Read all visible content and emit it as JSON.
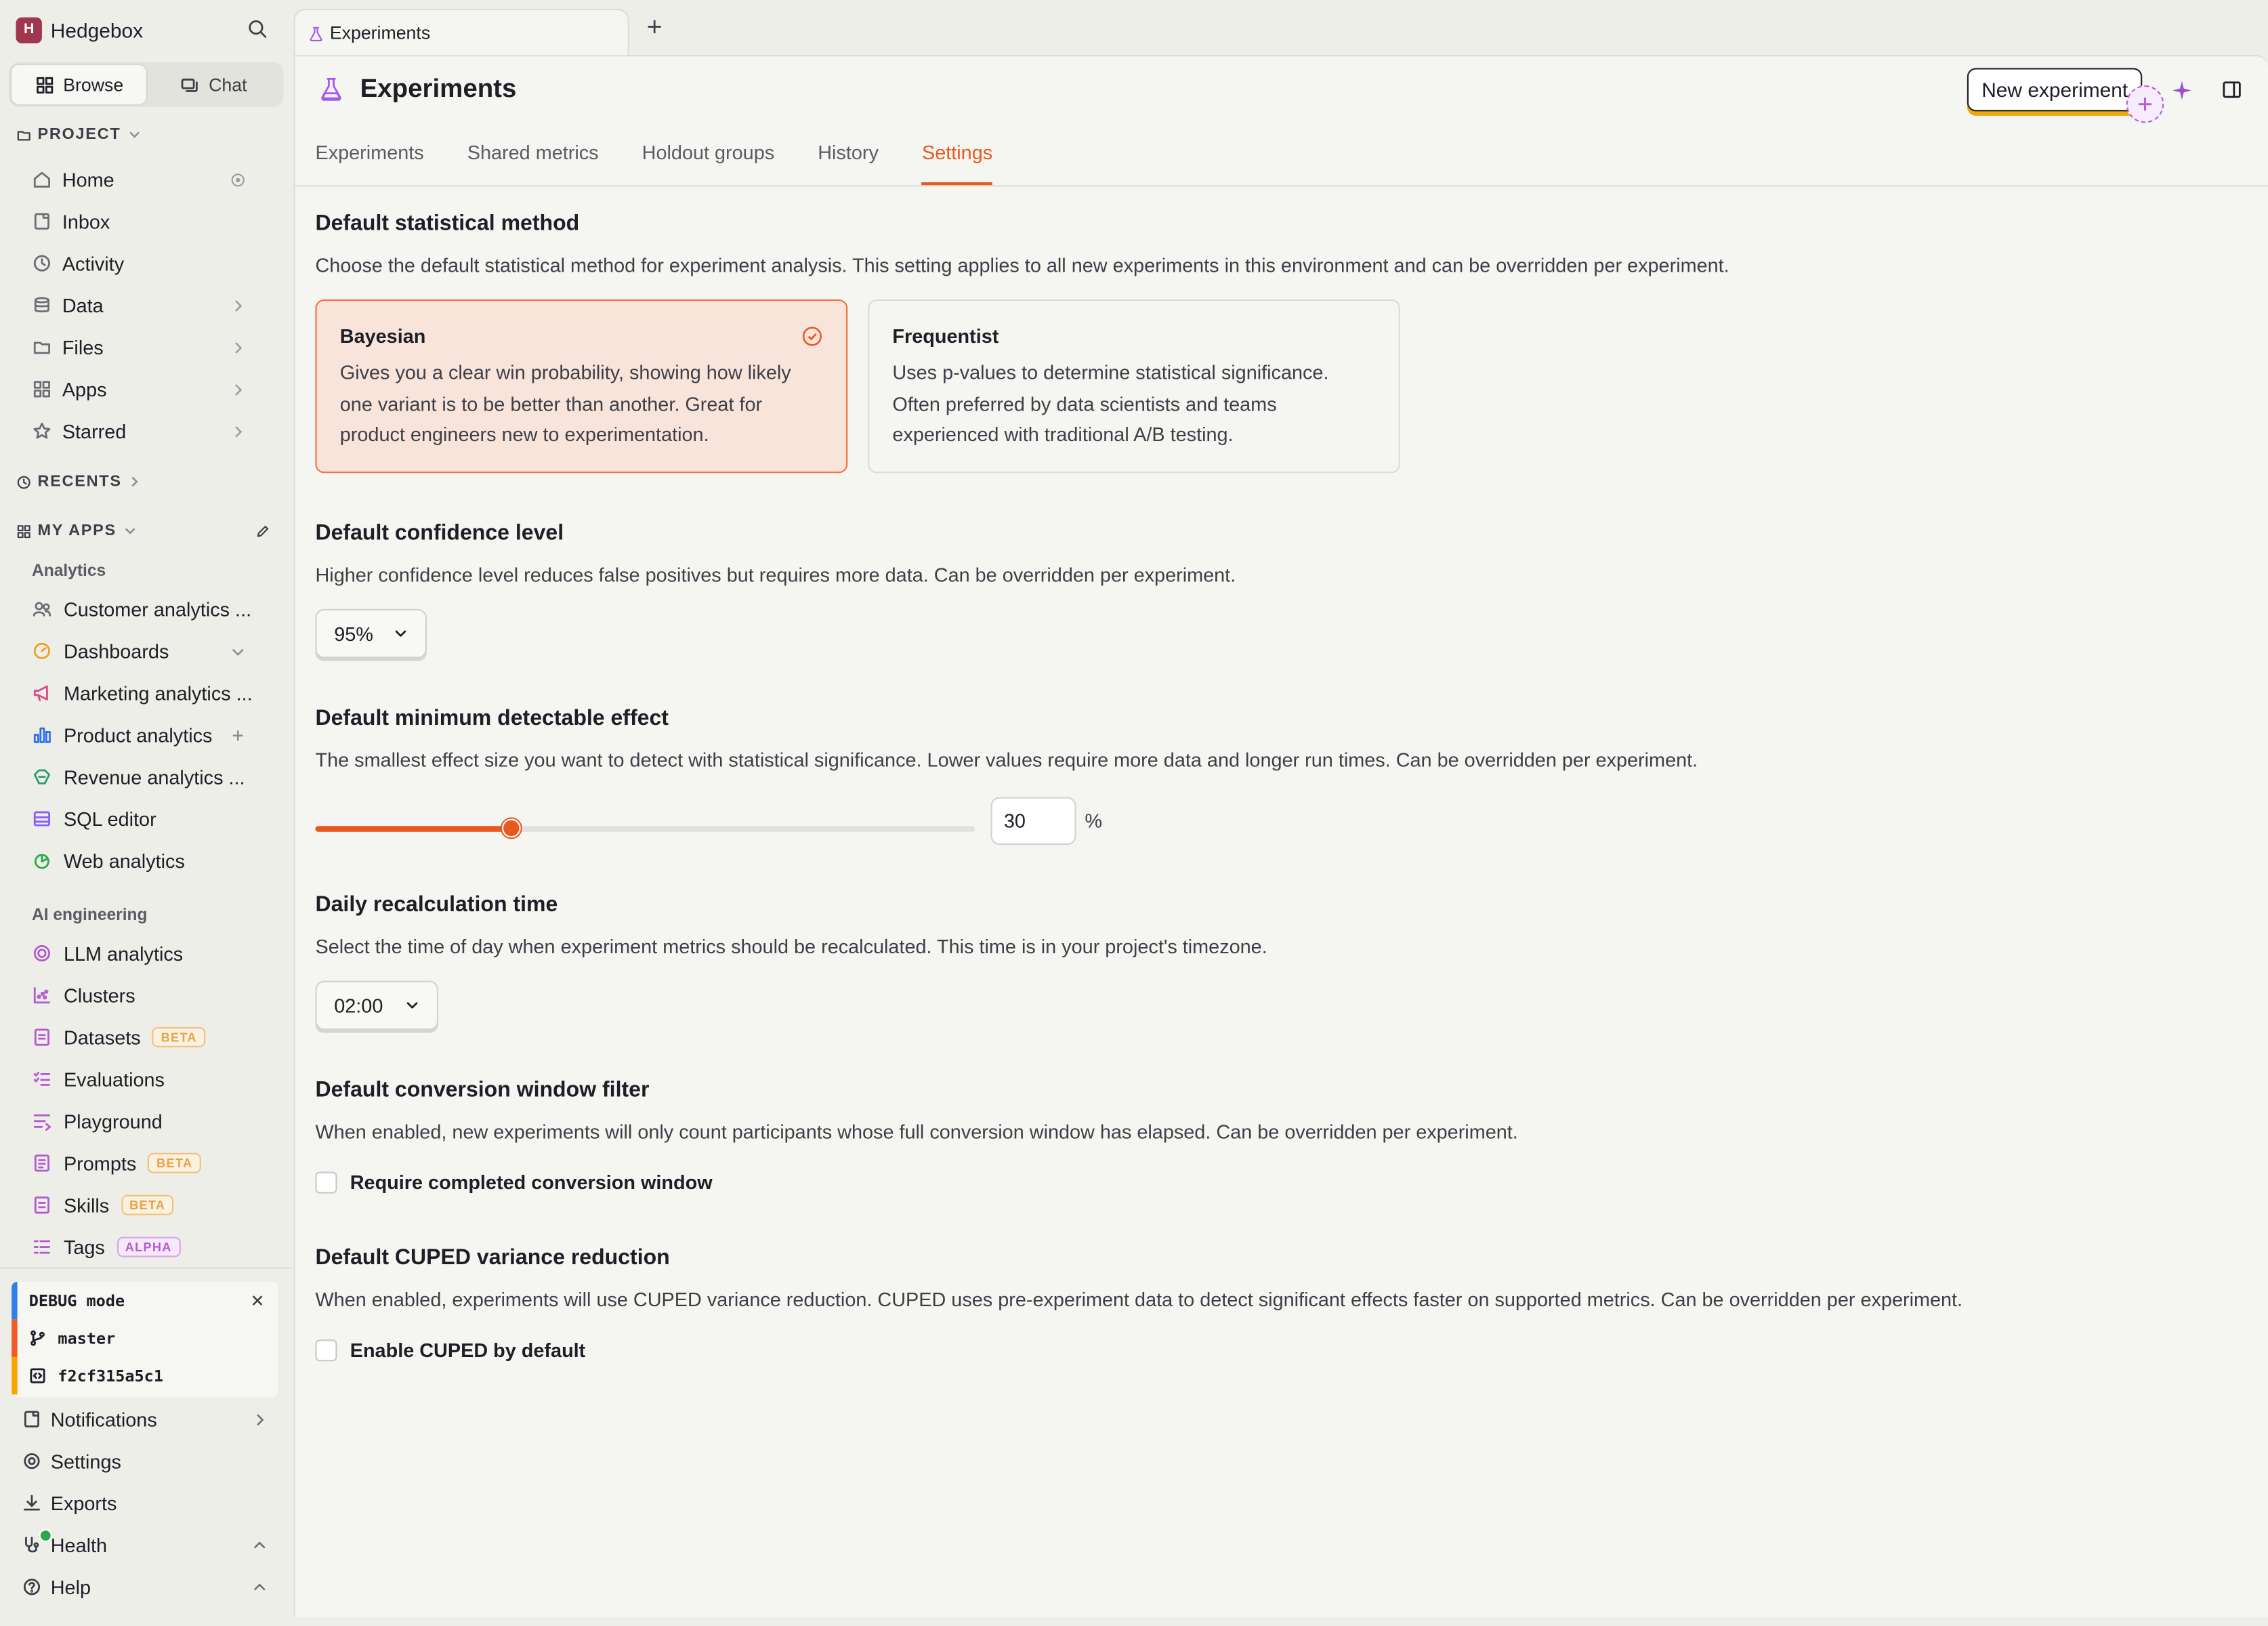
{
  "workspace": {
    "name": "Hedgebox",
    "avatar_letter": "H"
  },
  "sidebar": {
    "tabs": [
      {
        "label": "Browse"
      },
      {
        "label": "Chat"
      }
    ],
    "project_label": "PROJECT",
    "nav": [
      {
        "label": "Home",
        "icon": "home-icon"
      },
      {
        "label": "Inbox",
        "icon": "inbox-icon"
      },
      {
        "label": "Activity",
        "icon": "clock-icon"
      },
      {
        "label": "Data",
        "icon": "database-icon"
      },
      {
        "label": "Files",
        "icon": "folder-icon"
      },
      {
        "label": "Apps",
        "icon": "grid-icon"
      },
      {
        "label": "Starred",
        "icon": "star-icon"
      }
    ],
    "recents_label": "RECENTS",
    "my_apps_label": "MY APPS",
    "analytics_label": "Analytics",
    "analytics": [
      {
        "label": "Customer analytics ...",
        "icon": "users-icon"
      },
      {
        "label": "Dashboards",
        "icon": "dashboard-icon"
      },
      {
        "label": "Marketing analytics ...",
        "icon": "megaphone-icon"
      },
      {
        "label": "Product analytics",
        "icon": "bar-chart-icon"
      },
      {
        "label": "Revenue analytics ...",
        "icon": "revenue-icon"
      },
      {
        "label": "SQL editor",
        "icon": "sql-icon"
      },
      {
        "label": "Web analytics",
        "icon": "web-analytics-icon"
      }
    ],
    "ai_label": "AI engineering",
    "ai": [
      {
        "label": "LLM analytics",
        "icon": "llm-icon"
      },
      {
        "label": "Clusters",
        "icon": "clusters-icon"
      },
      {
        "label": "Datasets",
        "icon": "dataset-icon",
        "badge": "BETA"
      },
      {
        "label": "Evaluations",
        "icon": "evaluations-icon"
      },
      {
        "label": "Playground",
        "icon": "playground-icon"
      },
      {
        "label": "Prompts",
        "icon": "prompts-icon",
        "badge": "BETA"
      },
      {
        "label": "Skills",
        "icon": "skills-icon",
        "badge": "BETA"
      },
      {
        "label": "Tags",
        "icon": "tags-icon",
        "badge": "ALPHA"
      }
    ],
    "debug": {
      "mode": "DEBUG mode",
      "branch": "master",
      "commit": "f2cf315a5c1"
    },
    "footer": [
      {
        "label": "Notifications"
      },
      {
        "label": "Settings"
      },
      {
        "label": "Exports"
      },
      {
        "label": "Health"
      },
      {
        "label": "Help"
      }
    ]
  },
  "tab": {
    "label": "Experiments"
  },
  "page": {
    "title": "Experiments",
    "new_button": "New experiment",
    "subtabs": [
      "Experiments",
      "Shared metrics",
      "Holdout groups",
      "History",
      "Settings"
    ],
    "active_subtab": "Settings"
  },
  "settings": {
    "statistical_method": {
      "title": "Default statistical method",
      "desc": "Choose the default statistical method for experiment analysis. This setting applies to all new experiments in this environment and can be overridden per experiment.",
      "options": [
        {
          "title": "Bayesian",
          "desc": "Gives you a clear win probability, showing how likely one variant is to be better than another. Great for product engineers new to experimentation.",
          "selected": true
        },
        {
          "title": "Frequentist",
          "desc": "Uses p-values to determine statistical significance. Often preferred by data scientists and teams experienced with traditional A/B testing.",
          "selected": false
        }
      ]
    },
    "confidence": {
      "title": "Default confidence level",
      "desc": "Higher confidence level reduces false positives but requires more data. Can be overridden per experiment.",
      "value": "95%"
    },
    "mde": {
      "title": "Default minimum detectable effect",
      "desc": "The smallest effect size you want to detect with statistical significance. Lower values require more data and longer run times. Can be overridden per experiment.",
      "value": "30",
      "unit": "%",
      "fill_fraction": 0.297
    },
    "recalc": {
      "title": "Daily recalculation time",
      "desc": "Select the time of day when experiment metrics should be recalculated. This time is in your project's timezone.",
      "value": "02:00"
    },
    "conversion": {
      "title": "Default conversion window filter",
      "desc": "When enabled, new experiments will only count participants whose full conversion window has elapsed. Can be overridden per experiment.",
      "checkbox_label": "Require completed conversion window"
    },
    "cuped": {
      "title": "Default CUPED variance reduction",
      "desc": "When enabled, experiments will use CUPED variance reduction. CUPED uses pre-experiment data to detect significant effects faster on supported metrics. Can be overridden per experiment.",
      "checkbox_label": "Enable CUPED by default"
    }
  },
  "colors": {
    "accent": "#e8581f",
    "brand_avatar": "#a1374e",
    "selected_card_bg": "#f9e4db",
    "cta_shadow": "#f0a90d"
  }
}
